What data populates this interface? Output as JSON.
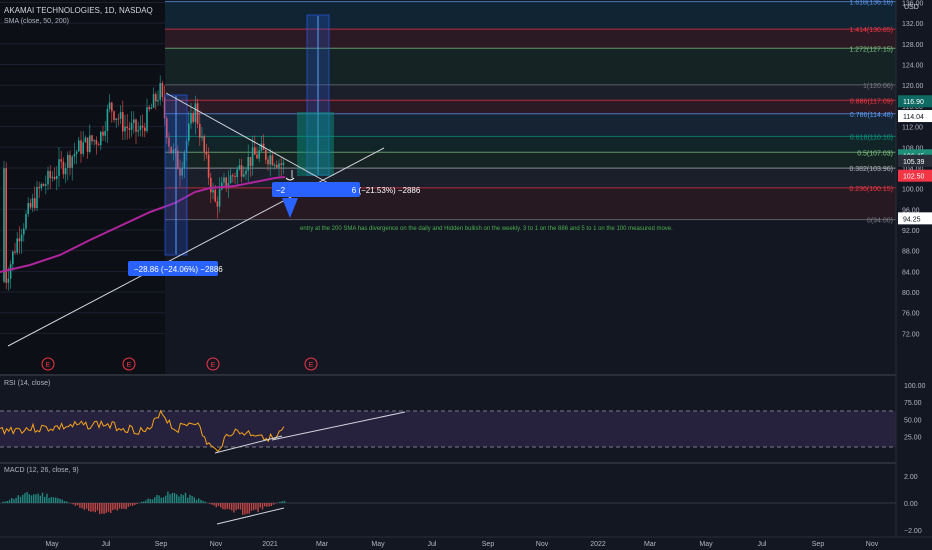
{
  "header": {
    "symbol_line": "AKAMAI TECHNOLOGIES, 1D, NASDAQ",
    "sma_label": "SMA (close, 50, 200)",
    "currency": "USD"
  },
  "price_axis": {
    "ticks": [
      "136.00",
      "132.00",
      "128.00",
      "124.00",
      "120.00",
      "116.00",
      "112.00",
      "108.00",
      "104.00",
      "100.00",
      "96.00",
      "92.00",
      "88.00",
      "84.00",
      "80.00",
      "76.00",
      "72.00"
    ],
    "ticks_values": [
      136,
      132,
      128,
      124,
      120,
      116,
      112,
      108,
      104,
      100,
      96,
      92,
      88,
      84,
      80,
      76,
      72
    ],
    "badges": [
      {
        "text": "116.90",
        "value": 116.9,
        "color": "#0e6a63"
      },
      {
        "text": "114.04",
        "value": 114.04,
        "color": "#ffffff",
        "fg": "#131722"
      },
      {
        "text": "106.45",
        "value": 106.45,
        "color": "#1f8f7c"
      },
      {
        "text": "105.39",
        "value": 105.39,
        "color": "#2a2e39"
      },
      {
        "text": "102.50",
        "value": 102.5,
        "color": "#f23645"
      },
      {
        "text": "94.25",
        "value": 94.25,
        "color": "#ffffff",
        "fg": "#131722"
      }
    ]
  },
  "fib_levels": [
    {
      "label": "1.618(136.16)",
      "value": 136.16,
      "color": "#5b9cf6"
    },
    {
      "label": "1.414(130.85)",
      "value": 130.85,
      "color": "#f23645"
    },
    {
      "label": "1.272(127.15)",
      "value": 127.15,
      "color": "#81c784"
    },
    {
      "label": "1(120.06)",
      "value": 120.06,
      "color": "#787b86"
    },
    {
      "label": "0.886(117.09)",
      "value": 117.09,
      "color": "#f23645"
    },
    {
      "label": "0.786(114.48)",
      "value": 114.48,
      "color": "#5b9cf6"
    },
    {
      "label": "0.618(110.10)",
      "value": 110.1,
      "color": "#089981"
    },
    {
      "label": "0.5(107.03)",
      "value": 107.03,
      "color": "#81c784"
    },
    {
      "label": "0.382(103.96)",
      "value": 103.96,
      "color": "#b2b5be"
    },
    {
      "label": "0.236(100.15)",
      "value": 100.15,
      "color": "#f23645"
    },
    {
      "label": "0(94.00)",
      "value": 94.0,
      "color": "#787b86"
    }
  ],
  "annotations": {
    "measure_1": "−28.86 (−24.06%) −2886",
    "measure_2": "−2                              6 (−21.53%) −2886",
    "note": "entry at the 200 SMA has divergence on the daily and Hidden bullish on the weekly.  3 to 1 on the 886 and 5 to 1 on the 100 measured move.",
    "earnings_marker": "E"
  },
  "rsi": {
    "label": "RSI (14, close)",
    "ticks": [
      "100.00",
      "75.00",
      "50.00",
      "25.00"
    ],
    "ticks_values": [
      100,
      75,
      50,
      25
    ]
  },
  "macd": {
    "label": "MACD (12, 26, close, 9)",
    "ticks": [
      "2.00",
      "0.00",
      "−2.00"
    ],
    "ticks_values": [
      2,
      0,
      -2
    ]
  },
  "time_axis": {
    "labels": [
      "May",
      "Jul",
      "Sep",
      "Nov",
      "2021",
      "Mar",
      "May",
      "Jul",
      "Sep",
      "Nov",
      "2022",
      "Mar",
      "May",
      "Jul",
      "Sep",
      "Nov"
    ]
  },
  "colors": {
    "background": "#131722",
    "sma200": "#b0259e",
    "up": "#26a69a",
    "down": "#ef5350",
    "rsi_line": "#f7a21b",
    "rsi_band": "#7e57c2"
  }
}
